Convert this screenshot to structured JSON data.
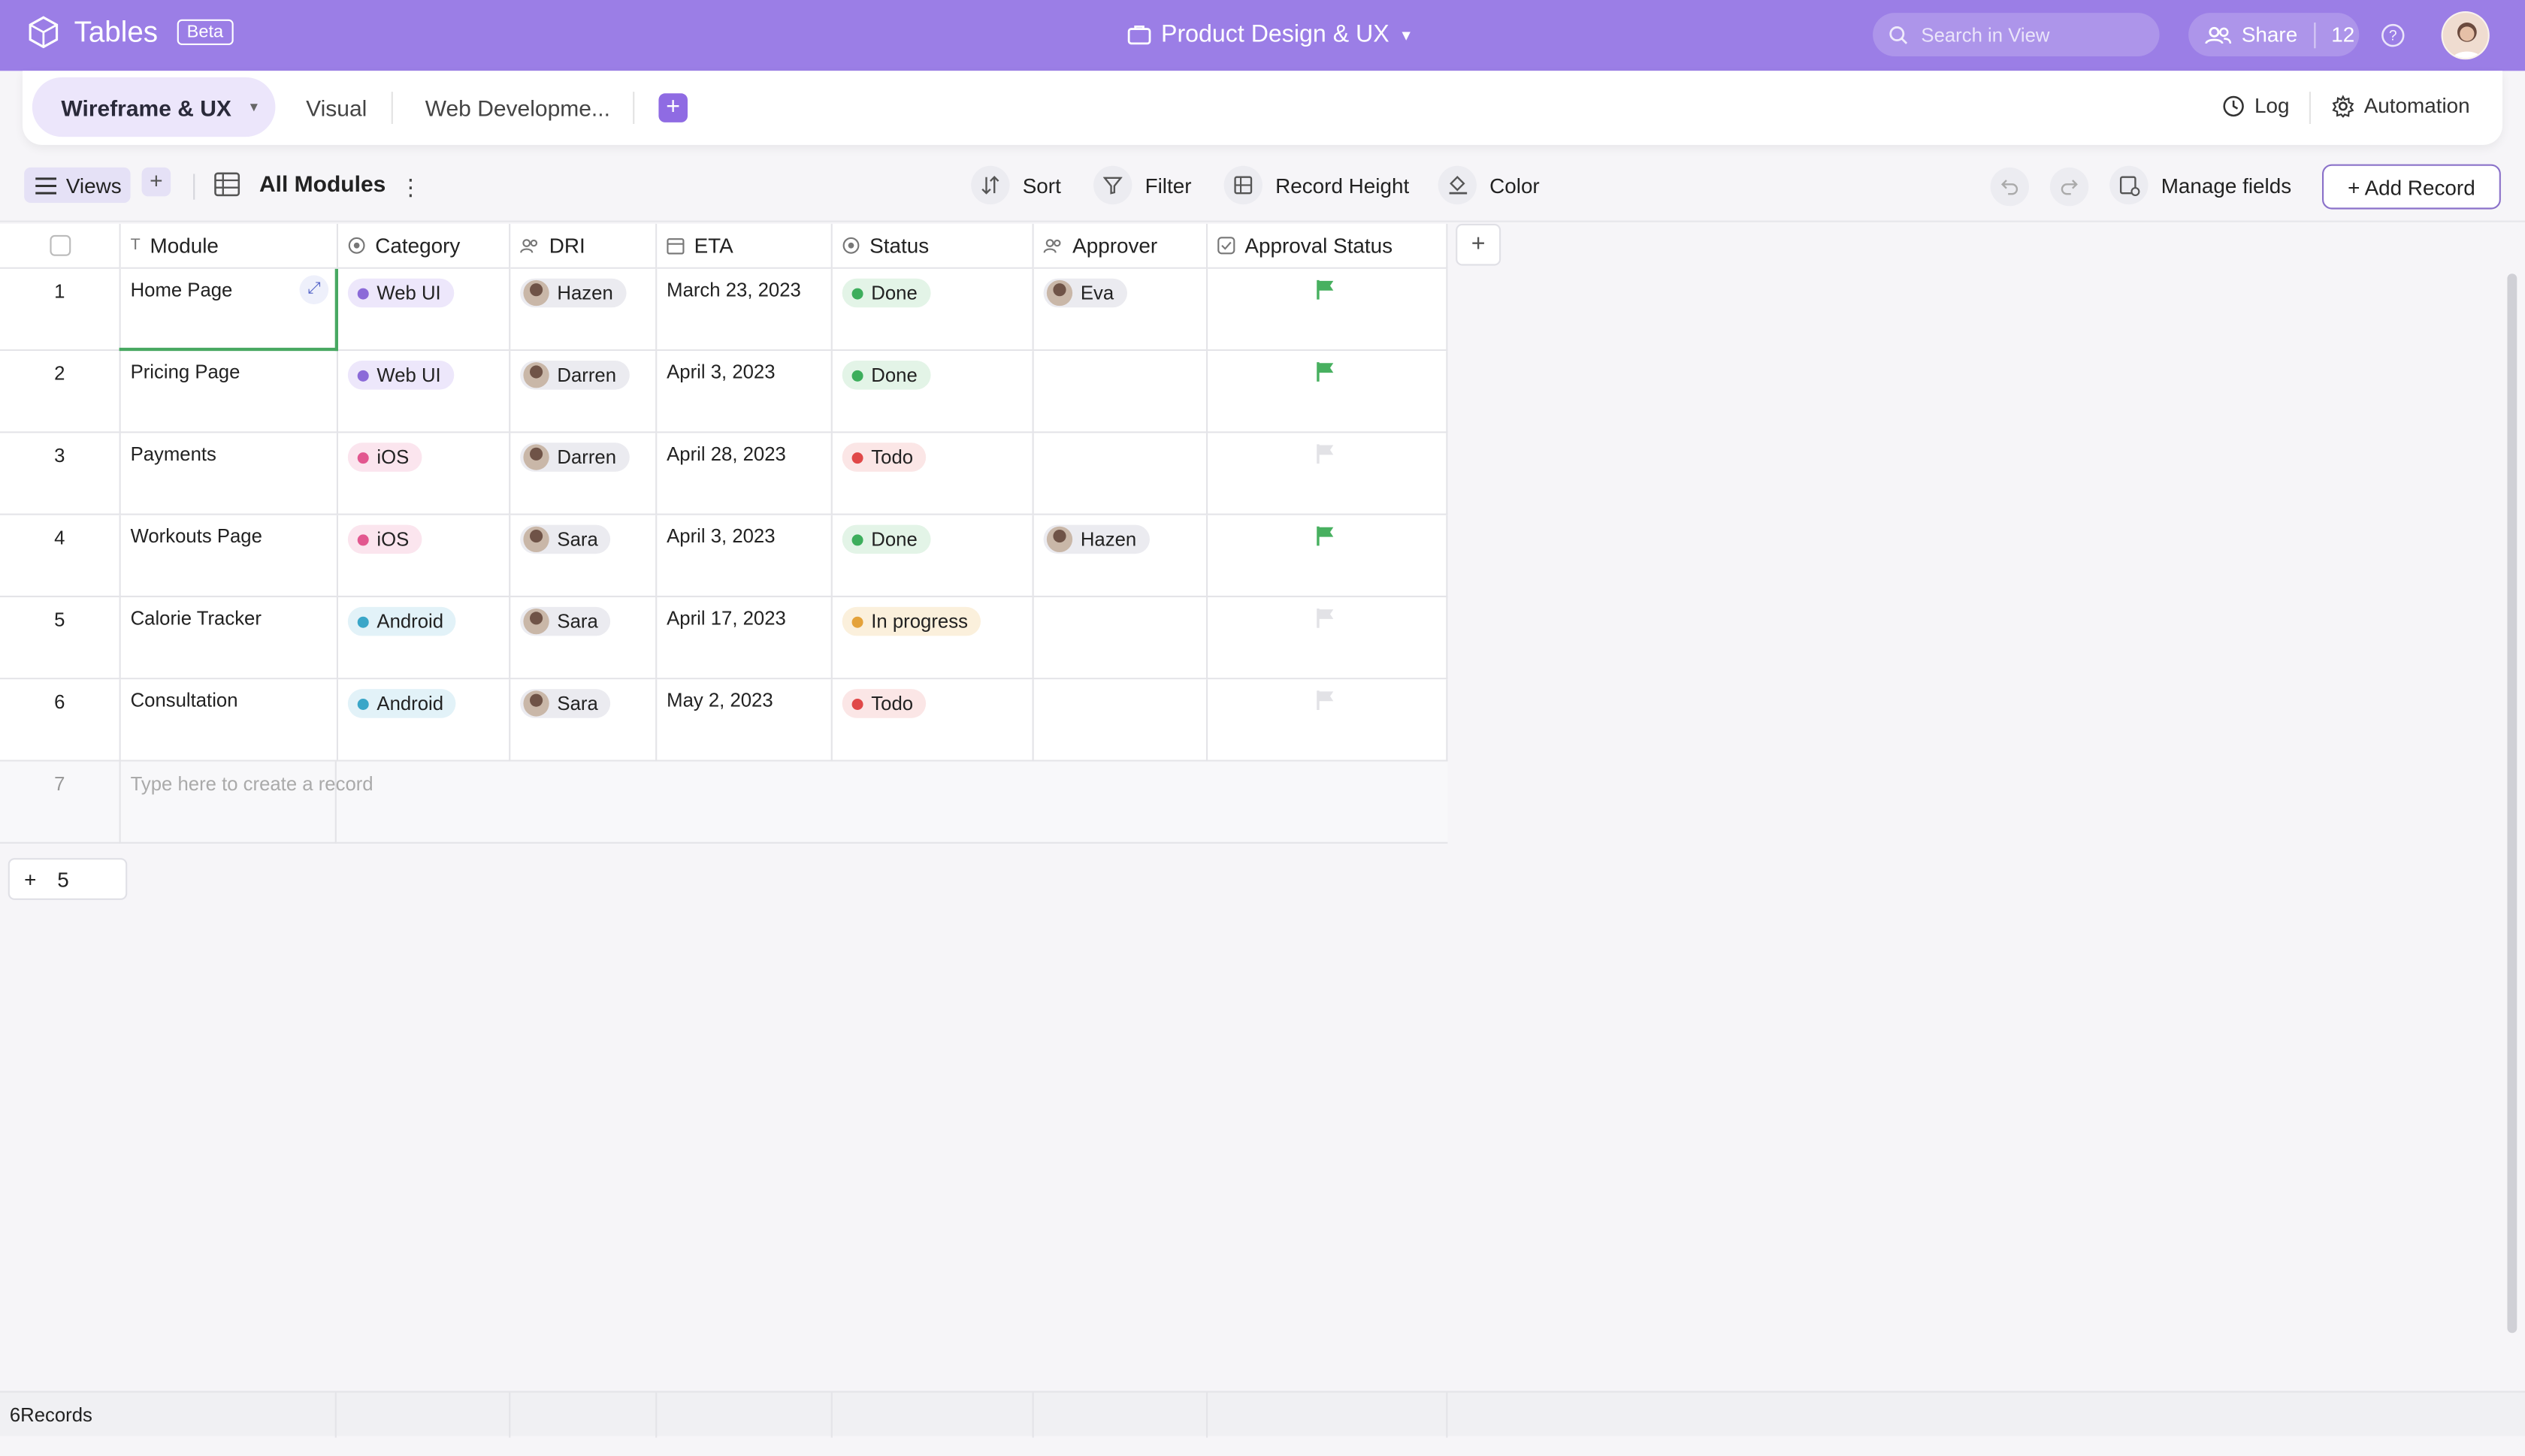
{
  "app": {
    "name": "Tables",
    "badge": "Beta"
  },
  "header": {
    "title": "Product Design & UX",
    "search_placeholder": "Search in View",
    "share_label": "Share",
    "share_count": "12"
  },
  "tabs": [
    {
      "label": "Wireframe & UX",
      "active": true
    },
    {
      "label": "Visual"
    },
    {
      "label": "Web Developme..."
    }
  ],
  "tab_actions": {
    "log": "Log",
    "automation": "Automation"
  },
  "toolbar": {
    "views": "Views",
    "view_name": "All Modules",
    "sort": "Sort",
    "filter": "Filter",
    "record_height": "Record Height",
    "color": "Color",
    "manage_fields": "Manage fields",
    "add_record": "+ Add Record"
  },
  "columns": [
    "Module",
    "Category",
    "DRI",
    "ETA",
    "Status",
    "Approver",
    "Approval Status"
  ],
  "rows": [
    {
      "num": "1",
      "module": "Home Page",
      "category": "Web UI",
      "dri": "Hazen",
      "eta": "March 23, 2023",
      "status": "Done",
      "approver": "Eva",
      "approved": true
    },
    {
      "num": "2",
      "module": "Pricing Page",
      "category": "Web UI",
      "dri": "Darren",
      "eta": "April 3, 2023",
      "status": "Done",
      "approver": "",
      "approved": true
    },
    {
      "num": "3",
      "module": "Payments",
      "category": "iOS",
      "dri": "Darren",
      "eta": "April 28, 2023",
      "status": "Todo",
      "approver": "",
      "approved": false
    },
    {
      "num": "4",
      "module": "Workouts Page",
      "category": "iOS",
      "dri": "Sara",
      "eta": "April 3, 2023",
      "status": "Done",
      "approver": "Hazen",
      "approved": true
    },
    {
      "num": "5",
      "module": "Calorie Tracker",
      "category": "Android",
      "dri": "Sara",
      "eta": "April 17, 2023",
      "status": "In progress",
      "approver": "",
      "approved": false
    },
    {
      "num": "6",
      "module": "Consultation",
      "category": "Android",
      "dri": "Sara",
      "eta": "May 2, 2023",
      "status": "Todo",
      "approver": "",
      "approved": false
    }
  ],
  "new_row": {
    "num": "7",
    "placeholder": "Type here to create a record"
  },
  "footer": {
    "add_count": "5",
    "records": "6Records"
  },
  "colors": {
    "accent": "#9b7ee6",
    "category": {
      "Web UI": "#8b6ad8",
      "iOS": "#e2578f",
      "Android": "#3aa6c8"
    },
    "category_bg": {
      "Web UI": "#ede7fb",
      "iOS": "#fbe5ee",
      "Android": "#e2f2f8"
    },
    "status": {
      "Done": "#3dae5c",
      "Todo": "#e04848",
      "In progress": "#e4a23a"
    },
    "status_bg": {
      "Done": "#e3f4e7",
      "Todo": "#fbe6e6",
      "In progress": "#fbf0dc"
    },
    "flag_on": "#48b060",
    "flag_off": "#e2e2e6"
  }
}
